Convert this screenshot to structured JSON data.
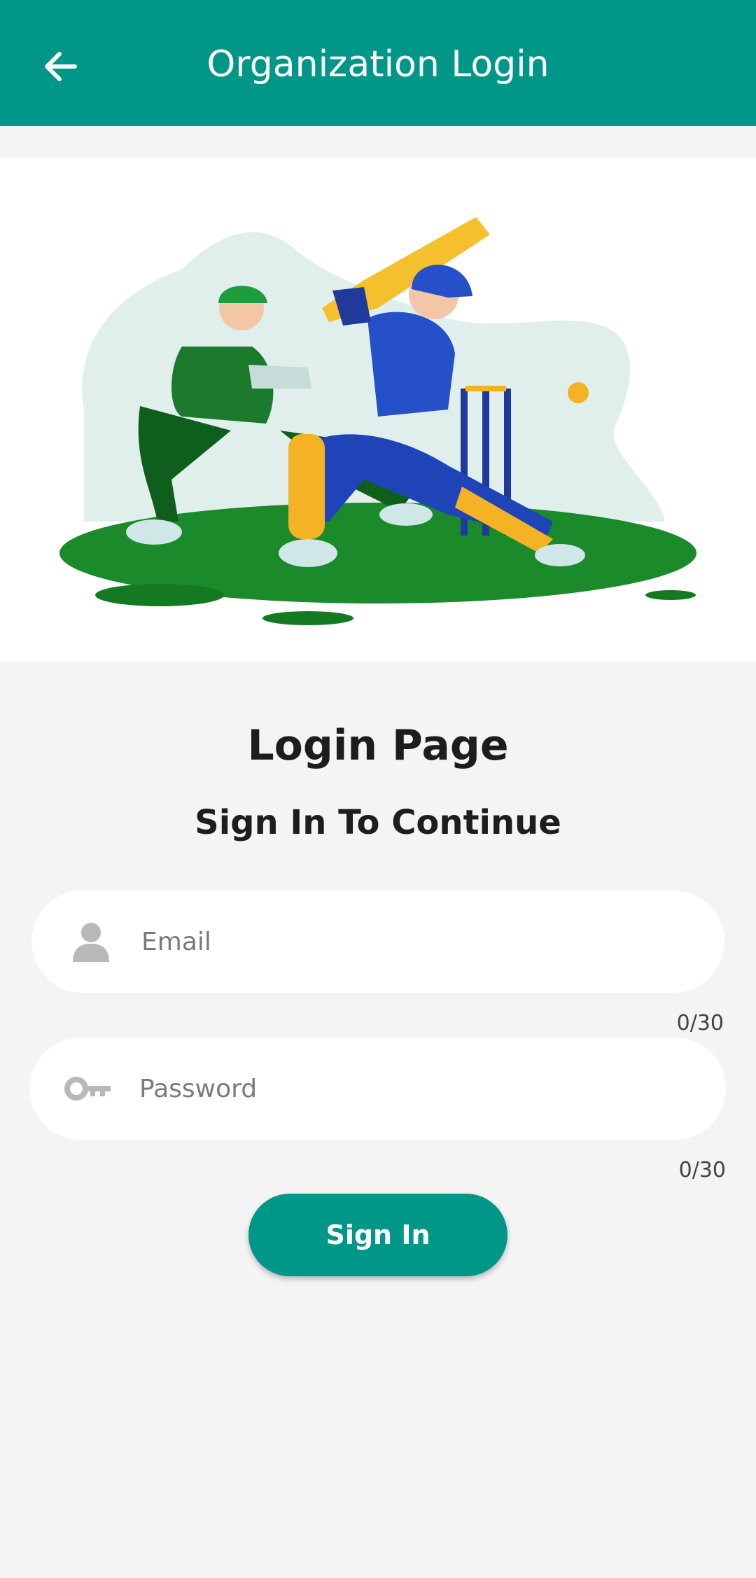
{
  "appbar": {
    "title": "Organization Login",
    "back_icon": "arrow-left-icon",
    "color": "#009688"
  },
  "hero": {
    "illustration": "cricket-batsman-and-wicketkeeper-illustration"
  },
  "login": {
    "title": "Login Page",
    "subtitle": "Sign In To Continue"
  },
  "email": {
    "placeholder": "Email",
    "counter": "0/30",
    "icon": "person-icon"
  },
  "password": {
    "placeholder": "Password",
    "counter": "0/30",
    "icon": "key-icon"
  },
  "signin": {
    "label": "Sign In"
  }
}
